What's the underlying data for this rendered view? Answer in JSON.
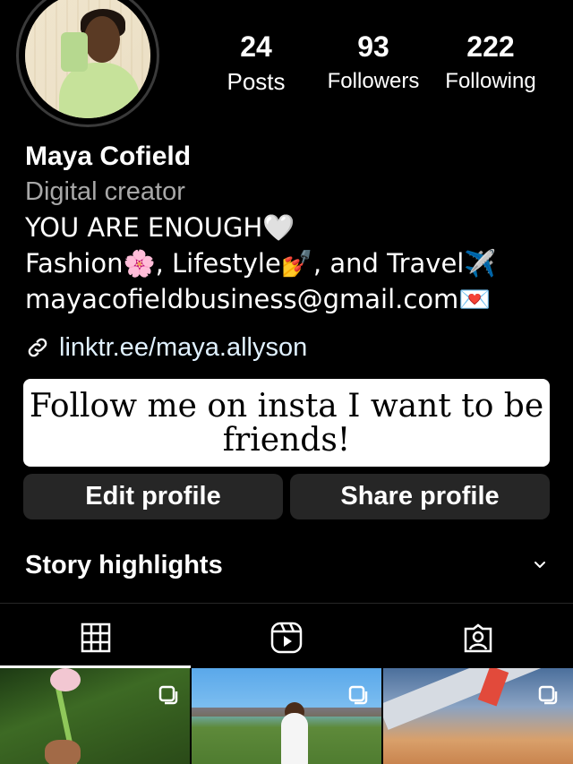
{
  "profile": {
    "avatar_alt": "profile photo",
    "name": "Maya Cofield",
    "category": "Digital creator",
    "bio_lines": [
      "YOU ARE ENOUGH🤍",
      "Fashion🌸, Lifestyle💅, and Travel✈️",
      "mayacofieldbusiness@gmail.com💌"
    ],
    "link": "linktr.ee/maya.allyson"
  },
  "stats": {
    "posts": {
      "value": "24",
      "label": "Posts"
    },
    "followers": {
      "value": "93",
      "label": "Followers"
    },
    "following": {
      "value": "222",
      "label": "Following"
    }
  },
  "sticker": {
    "text": "Follow me on insta I want to be friends!"
  },
  "buttons": {
    "edit_profile": "Edit profile",
    "share_profile": "Share profile"
  },
  "highlights": {
    "title": "Story highlights"
  },
  "tabs": [
    {
      "id": "grid",
      "icon": "grid-icon",
      "selected": true
    },
    {
      "id": "reels",
      "icon": "reels-icon",
      "selected": false
    },
    {
      "id": "tagged",
      "icon": "tagged-icon",
      "selected": false
    }
  ],
  "colors": {
    "background": "#000000",
    "button": "#262626",
    "secondary_text": "#a8a8a8",
    "link_text": "#e0f1ff"
  }
}
